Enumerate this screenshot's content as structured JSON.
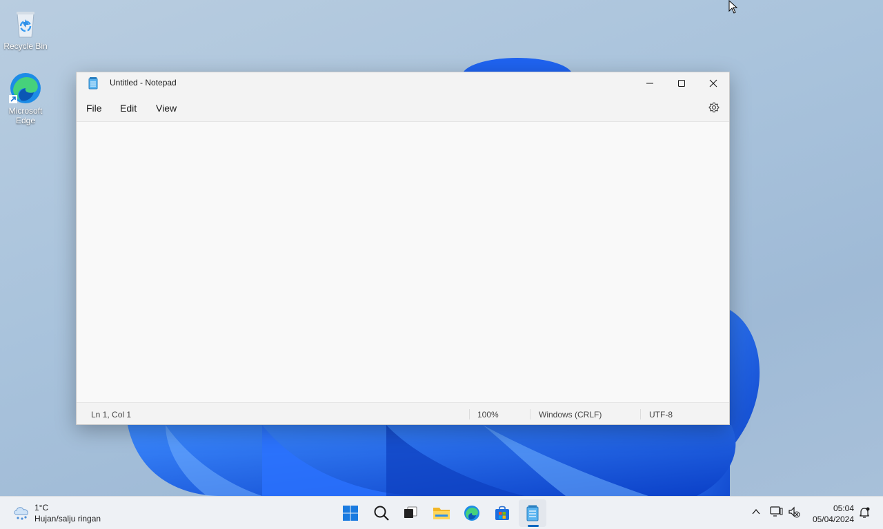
{
  "desktop": {
    "icons": [
      {
        "label": "Recycle Bin",
        "icon": "recycle-bin-icon"
      },
      {
        "label": "Microsoft Edge",
        "icon": "edge-icon"
      }
    ]
  },
  "window": {
    "title": "Untitled - Notepad",
    "menu": [
      "File",
      "Edit",
      "View"
    ],
    "editor_text": "",
    "status": {
      "position": "Ln 1, Col 1",
      "zoom": "100%",
      "line_ending": "Windows (CRLF)",
      "encoding": "UTF-8"
    }
  },
  "taskbar": {
    "weather": {
      "temp": "1°C",
      "desc": "Hujan/salju ringan"
    },
    "apps": [
      "start-icon",
      "search-icon",
      "task-view-icon",
      "file-explorer-icon",
      "edge-icon",
      "store-icon",
      "notepad-icon"
    ],
    "clock": {
      "time": "05:04",
      "date": "05/04/2024"
    }
  },
  "colors": {
    "accent": "#0067c0",
    "wallpaper_blue": "#1b5fe0"
  }
}
